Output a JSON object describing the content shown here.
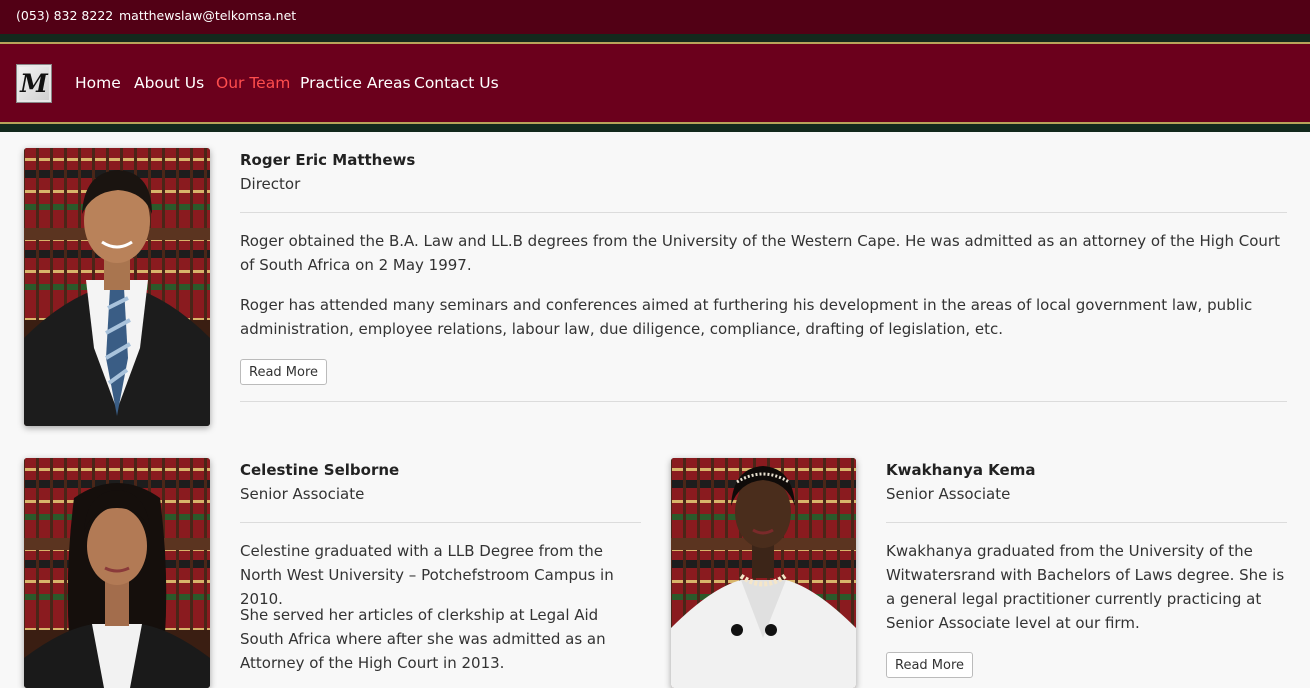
{
  "topbar": {
    "phone": "(053) 832 8222",
    "email": "matthewslaw@telkomsa.net"
  },
  "logo": {
    "letter": "M"
  },
  "nav": {
    "items": [
      {
        "label": "Home"
      },
      {
        "label": "About Us"
      },
      {
        "label": "Our Team",
        "active": true
      },
      {
        "label": "Practice Areas"
      },
      {
        "label": "Contact Us"
      }
    ]
  },
  "team": [
    {
      "name": "Roger Eric Matthews",
      "role": "Director",
      "paragraphs": [
        "Roger obtained the B.A. Law and LL.B degrees from the University of the Western Cape. He was admitted as an attorney of the High Court of South Africa on 2 May 1997.",
        "Roger has attended many seminars and conferences aimed at furthering his development in the areas of local government law, public administration, employee relations, labour law, due diligence, compliance, drafting of legislation, etc."
      ],
      "button": "Read More"
    },
    {
      "name": "Celestine Selborne",
      "role": "Senior Associate",
      "paragraphs": [
        "Celestine graduated with a LLB Degree from the North West University – Potchefstroom Campus in 2010.",
        "She served her articles of clerkship at Legal Aid South Africa where after she was admitted as an Attorney of the High Court in 2013."
      ]
    },
    {
      "name": "Kwakhanya Kema",
      "role": "Senior Associate",
      "paragraphs": [
        "Kwakhanya graduated from the University of the Witwatersrand with Bachelors of Laws degree. She is a general legal practitioner currently practicing at Senior Associate level at our firm."
      ],
      "button": "Read More"
    }
  ],
  "colors": {
    "topbar": "#520015",
    "navbar": "#6b001c",
    "accent": "#ff4d4d",
    "stripe_dark": "#13291d",
    "stripe_gold": "#b9a35a"
  }
}
